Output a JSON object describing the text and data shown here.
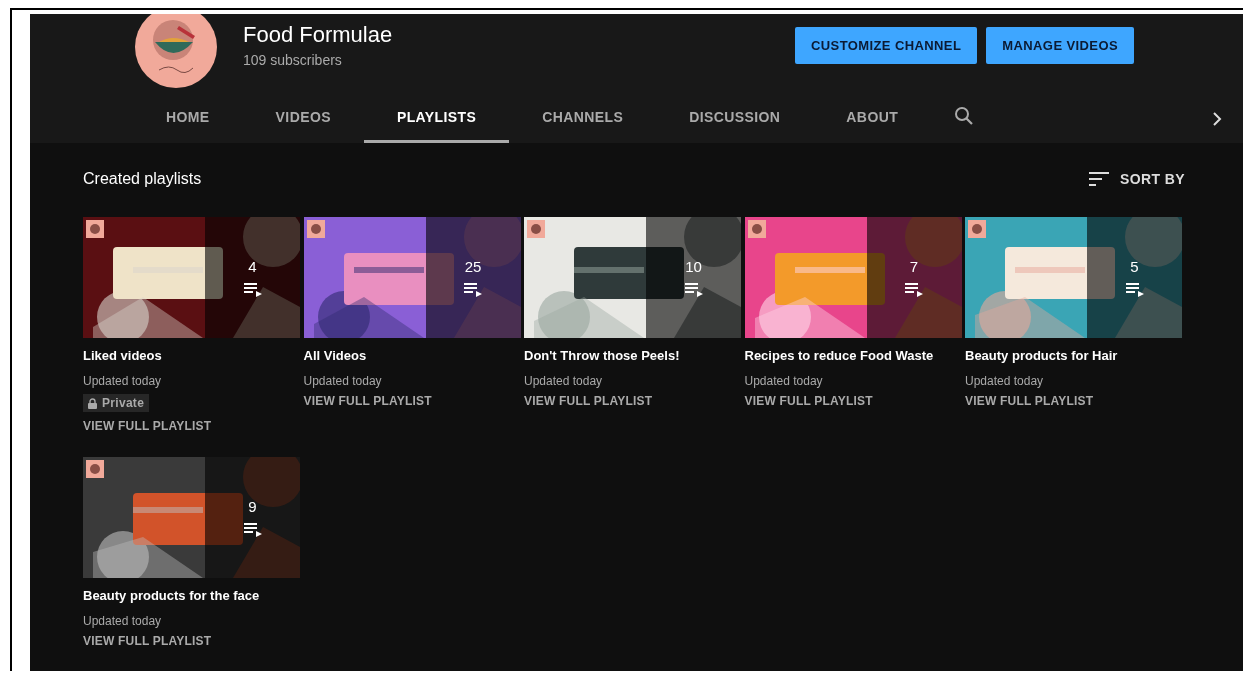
{
  "channel": {
    "name": "Food Formulae",
    "subscribers": "109 subscribers"
  },
  "buttons": [
    "CUSTOMIZE CHANNEL",
    "MANAGE VIDEOS"
  ],
  "tabs": [
    {
      "label": "HOME",
      "selected": false
    },
    {
      "label": "VIDEOS",
      "selected": false
    },
    {
      "label": "PLAYLISTS",
      "selected": true
    },
    {
      "label": "CHANNELS",
      "selected": false
    },
    {
      "label": "DISCUSSION",
      "selected": false
    },
    {
      "label": "ABOUT",
      "selected": false
    }
  ],
  "section": {
    "title": "Created playlists",
    "sort_label": "SORT BY"
  },
  "playlists": [
    {
      "title": "Liked videos",
      "count": "4",
      "updated": "Updated today",
      "badge": "Private",
      "link": "VIEW FULL PLAYLIST"
    },
    {
      "title": "All Videos",
      "count": "25",
      "updated": "Updated today",
      "link": "VIEW FULL PLAYLIST"
    },
    {
      "title": "Don't Throw those Peels!",
      "count": "10",
      "updated": "Updated today",
      "link": "VIEW FULL PLAYLIST"
    },
    {
      "title": "Recipes to reduce Food Waste",
      "count": "7",
      "updated": "Updated today",
      "link": "VIEW FULL PLAYLIST"
    },
    {
      "title": "Beauty products for Hair",
      "count": "5",
      "updated": "Updated today",
      "link": "VIEW FULL PLAYLIST"
    },
    {
      "title": "Beauty products for the face",
      "count": "9",
      "updated": "Updated today",
      "link": "VIEW FULL PLAYLIST"
    }
  ]
}
